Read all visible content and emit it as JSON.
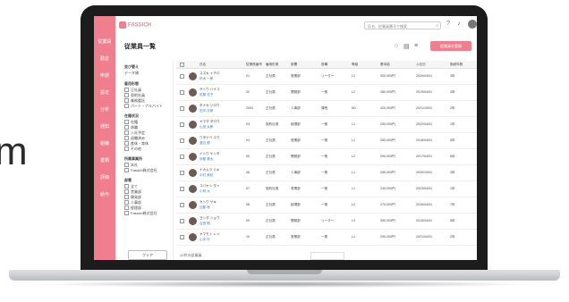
{
  "marketing": {
    "partial_word": "m"
  },
  "app": {
    "brand": "FASSICH",
    "search_placeholder": "氏名、従業員番号で検索",
    "page_title": "従業員一覧",
    "add_button": "従業員を登録",
    "rail_items": [
      "従業員",
      "勤怠",
      "申請",
      "設定",
      "分析",
      "通知",
      "組織",
      "書類",
      "評価",
      "給与"
    ],
    "filter": {
      "sort_label": "並び替え",
      "sort_value": "データ順",
      "sections": [
        {
          "title": "雇用形態",
          "options": [
            "正社員",
            "契約社員",
            "業務委託",
            "パート・アルバイト"
          ]
        },
        {
          "title": "在籍状況",
          "options": [
            "在籍",
            "休職",
            "入社予定",
            "退職済み",
            "産休・育休",
            "その他"
          ]
        },
        {
          "title": "所属事業所",
          "options": [
            "本社",
            "Fassich株式会社"
          ]
        },
        {
          "title": "部署",
          "options": [
            "全て",
            "営業部",
            "開発部",
            "人事部",
            "経理部",
            "Fassich株式会社"
          ]
        }
      ],
      "clear_button": "クリア"
    },
    "table": {
      "headers": [
        "氏名",
        "従業員番号",
        "雇用形態",
        "部署",
        "役職",
        "等級",
        "基本給",
        "入社日",
        "勤続年数"
      ],
      "rows": [
        {
          "name": "スズキ イチロ",
          "sub": "鈴木 一郎",
          "no": "01",
          "type": "正社員",
          "dept": "営業部",
          "pos": "リーダー",
          "grade": "L1",
          "salary": "300,000円",
          "joined": "2020/04/01",
          "years": "3年"
        },
        {
          "name": "サトウ ハナコ",
          "sub": "佐藤 花子",
          "no": "02",
          "type": "正社員",
          "dept": "開発部",
          "pos": "一般",
          "grade": "L2",
          "salary": "280,000円",
          "joined": "2019/04/01",
          "years": "4年"
        },
        {
          "name": "タナカ ジロウ",
          "sub": "田中 次郎",
          "no": "2004",
          "type": "正社員",
          "dept": "人事部",
          "pos": "課長",
          "grade": "M1",
          "salary": "420,000円",
          "joined": "2021/10/01",
          "years": "2年"
        },
        {
          "name": "ヤマダ タロウ",
          "sub": "山田 太郎",
          "no": "03",
          "type": "契約社員",
          "dept": "経理部",
          "pos": "一般",
          "grade": "L1",
          "salary": "250,000円",
          "joined": "2022/04/01",
          "years": "1年"
        },
        {
          "name": "ワタナベ ユウ",
          "sub": "渡辺 優",
          "no": "04",
          "type": "正社員",
          "dept": "営業部",
          "pos": "一般",
          "grade": "L1",
          "salary": "260,000円",
          "joined": "2018/04/01",
          "years": "5年"
        },
        {
          "name": "イトウ ケンタ",
          "sub": "伊藤 健太",
          "no": "05",
          "type": "正社員",
          "dept": "開発部",
          "pos": "一般",
          "grade": "L2",
          "salary": "290,000円",
          "joined": "2017/04/01",
          "years": "6年"
        },
        {
          "name": "ナカムラ ミキ",
          "sub": "中村 美紀",
          "no": "06",
          "type": "正社員",
          "dept": "人事部",
          "pos": "一般",
          "grade": "L1",
          "salary": "255,000円",
          "joined": "2020/10/01",
          "years": "3年"
        },
        {
          "name": "コバヤシ ダイ",
          "sub": "小林 大",
          "no": "07",
          "type": "契約社員",
          "dept": "営業部",
          "pos": "一般",
          "grade": "L1",
          "salary": "240,000円",
          "joined": "2023/04/01",
          "years": "1年"
        },
        {
          "name": "カトウ サキ",
          "sub": "加藤 咲",
          "no": "08",
          "type": "正社員",
          "dept": "経理部",
          "pos": "一般",
          "grade": "L2",
          "salary": "270,000円",
          "joined": "2016/04/01",
          "years": "7年"
        },
        {
          "name": "ヨシダ ショウ",
          "sub": "吉田 翔",
          "no": "09",
          "type": "正社員",
          "dept": "開発部",
          "pos": "リーダー",
          "grade": "L3",
          "salary": "350,000円",
          "joined": "2015/04/01",
          "years": "8年"
        },
        {
          "name": "ヤマモト レイ",
          "sub": "山本 玲",
          "no": "10",
          "type": "正社員",
          "dept": "営業部",
          "pos": "一般",
          "grade": "L1",
          "salary": "250,000円",
          "joined": "2021/04/01",
          "years": "2年"
        }
      ]
    },
    "footer": {
      "count_label": "10件の従業員"
    }
  },
  "colors": {
    "accent": "#ef7f8f"
  }
}
